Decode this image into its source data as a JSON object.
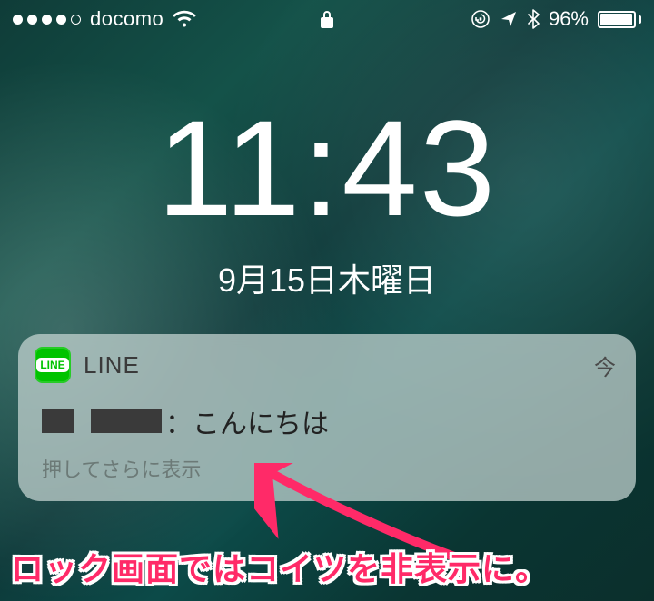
{
  "status": {
    "carrier": "docomo",
    "battery_percent": "96%"
  },
  "lock": {
    "time": "11:43",
    "date": "9月15日木曜日"
  },
  "notification": {
    "app_name": "LINE",
    "app_badge": "LINE",
    "time_label": "今",
    "message_text": "：こんにちは",
    "hint": "押してさらに表示"
  },
  "caption": "ロック画面ではコイツを非表示に。"
}
